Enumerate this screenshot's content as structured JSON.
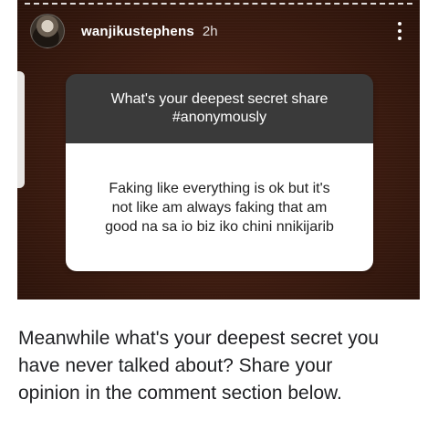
{
  "story": {
    "username": "wanjikustephens",
    "time_ago": "2h",
    "avatar_icon": "avatar-icon",
    "more_icon": "more-vertical-icon",
    "colors": {
      "background": "#3f1d11",
      "question_bg": "#3a3a3a",
      "answer_bg": "#ffffff"
    },
    "question": {
      "line1": "What's your deepest secret share",
      "line2": "#anonymously"
    },
    "answer": {
      "line1": "Faking like everything is ok but it's",
      "line2": "not like am always faking that am",
      "line3": "good na sa io biz iko chini nnikijarib"
    }
  },
  "caption": {
    "line1": "Meanwhile what's your deepest secret you",
    "line2": "have never talked about? Share your",
    "line3": "opinion in the comment section below."
  }
}
